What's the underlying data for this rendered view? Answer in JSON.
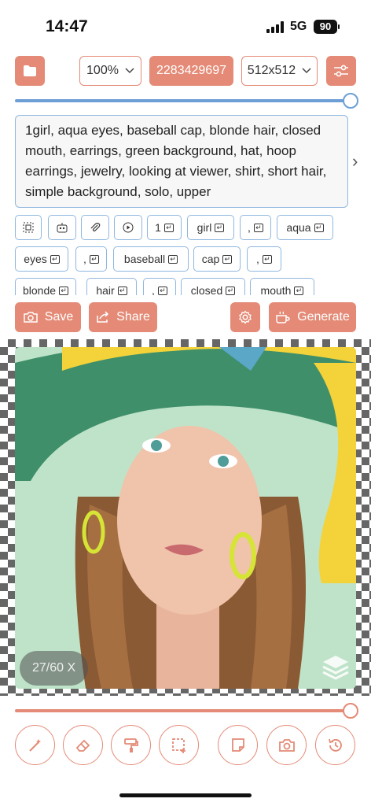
{
  "status": {
    "time": "14:47",
    "network": "5G",
    "battery": "90"
  },
  "toolbar": {
    "zoom": "100%",
    "seed": "2283429697",
    "size": "512x512"
  },
  "prompt": {
    "text": "1girl, aqua eyes, baseball cap, blonde hair, closed mouth, earrings, green background, hat, hoop earrings, jewelry, looking at viewer, shirt, short hair, simple background, solo, upper"
  },
  "chips": {
    "tokens": [
      "1",
      "girl",
      ",",
      "aqua",
      "eyes",
      ",",
      "baseball",
      "cap",
      ",",
      "blonde",
      "hair",
      ",",
      "closed",
      "mouth"
    ]
  },
  "actions": {
    "save": "Save",
    "share": "Share",
    "generate": "Generate"
  },
  "canvas": {
    "counter": "27/60 X"
  },
  "sliders": {
    "top_value": 1.0,
    "bottom_value": 1.0
  },
  "colors": {
    "accent": "#e48a76",
    "blue": "#8fb7df",
    "slider_blue": "#6d9fd6"
  },
  "icons": {
    "toolbar": [
      "folder-icon",
      "chevron-down-icon",
      "sliders-icon"
    ],
    "chips": [
      "select-icon",
      "robot-icon",
      "paperclip-icon",
      "play-icon"
    ],
    "actions": [
      "camera-icon",
      "share-icon",
      "gear-icon",
      "coffee-icon",
      "layers-icon"
    ],
    "tools": [
      "magic-wand-icon",
      "eraser-icon",
      "paint-roller-icon",
      "selection-icon",
      "note-icon",
      "camera-icon",
      "history-icon"
    ]
  }
}
